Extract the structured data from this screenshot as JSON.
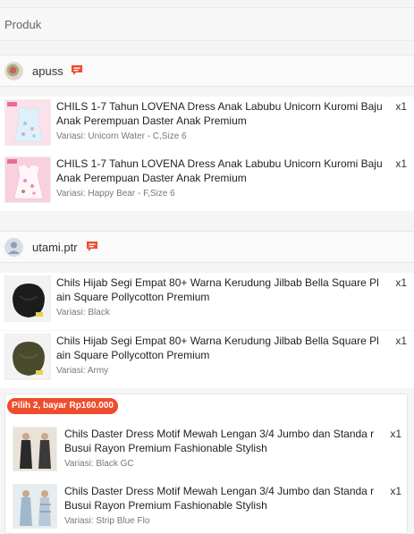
{
  "header": {
    "title": "Produk"
  },
  "shops": [
    {
      "name": "apuss",
      "items": [
        {
          "title": "CHILS 1-7 Tahun LOVENA Dress Anak Labubu Unicorn Kuromi Baju Anak Perempuan Daster Anak Premium",
          "qty": "x1",
          "variant": "Variasi: Unicorn Water - C,Size 6"
        },
        {
          "title": "CHILS 1-7 Tahun LOVENA Dress Anak Labubu Unicorn Kuromi Baju Anak Perempuan Daster Anak Premium",
          "qty": "x1",
          "variant": "Variasi: Happy Bear - F,Size 6"
        }
      ]
    },
    {
      "name": "utami.ptr",
      "items": [
        {
          "title": "Chils Hijab Segi Empat 80+ Warna Kerudung Jilbab Bella Square Pl ain Square Pollycotton Premium",
          "qty": "x1",
          "variant": "Variasi: Black"
        },
        {
          "title": "Chils Hijab Segi Empat 80+ Warna Kerudung Jilbab Bella Square Pl ain Square Pollycotton Premium",
          "qty": "x1",
          "variant": "Variasi: Army"
        }
      ],
      "bundle": {
        "badge": "Pilih 2, bayar Rp160.000",
        "items": [
          {
            "title": "Chils Daster Dress Motif Mewah Lengan 3/4 Jumbo dan Standa r Busui Rayon Premium Fashionable Stylish",
            "qty": "x1",
            "variant": "Variasi: Black GC"
          },
          {
            "title": "Chils Daster Dress Motif Mewah Lengan 3/4 Jumbo dan Standa r Busui Rayon Premium Fashionable Stylish",
            "qty": "x1",
            "variant": "Variasi: Strip Blue Flo"
          }
        ]
      }
    }
  ],
  "colors": {
    "accent": "#ee4d2d",
    "chat_icon": "#ee4d2d"
  },
  "icons": {
    "chat": "chat-bubble-icon"
  }
}
